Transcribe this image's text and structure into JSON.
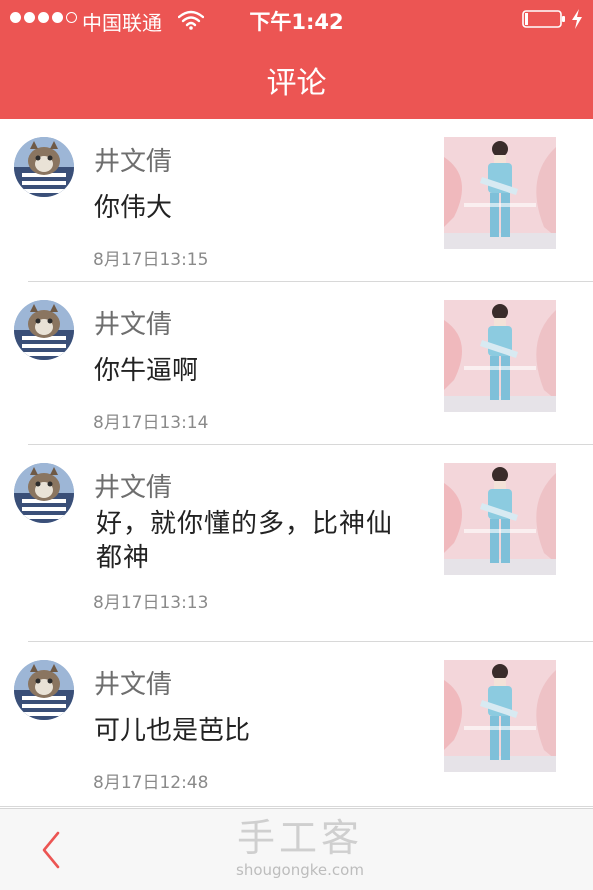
{
  "status_bar": {
    "carrier": "中国联通",
    "time": "下午1:42"
  },
  "header": {
    "title": "评论"
  },
  "comments": [
    {
      "username": "井文倩",
      "text": "你伟大",
      "time": "8月17日13:15"
    },
    {
      "username": "井文倩",
      "text": "你牛逼啊",
      "time": "8月17日13:14"
    },
    {
      "username": "井文倩",
      "text": "好，就你懂的多，比神仙都神",
      "time": "8月17日13:13"
    },
    {
      "username": "井文倩",
      "text": "可儿也是芭比",
      "time": "8月17日12:48"
    }
  ],
  "footer": {
    "watermark_logo": "手工客",
    "watermark_domain": "shougongke.com"
  },
  "icons": {
    "back": "chevron-left-icon",
    "wifi": "wifi-icon",
    "battery": "battery-icon",
    "charging": "lightning-icon"
  },
  "colors": {
    "accent": "#ec5553",
    "back_icon": "#ec5553"
  }
}
